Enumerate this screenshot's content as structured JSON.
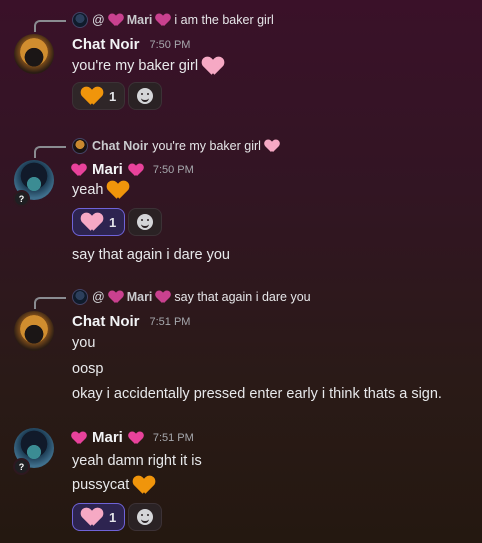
{
  "messages": [
    {
      "reply": {
        "prefix": "@",
        "name": "Mari",
        "text": "i am the baker girl"
      },
      "author": "Chat Noir",
      "time": "7:50 PM",
      "lines": [
        "you're my baker girl"
      ],
      "reaction_count": "1"
    },
    {
      "reply": {
        "name": "Chat Noir",
        "text": "you're my baker girl"
      },
      "author": "Mari",
      "time": "7:50 PM",
      "lines": [
        "yeah",
        "say that again i dare you"
      ],
      "reaction_count": "1",
      "avatar_badge": "?"
    },
    {
      "reply": {
        "prefix": "@",
        "name": "Mari",
        "text": "say that again i dare you"
      },
      "author": "Chat Noir",
      "time": "7:51 PM",
      "lines": [
        "you",
        "oosp",
        "okay i accidentally pressed enter early i think thats a sign."
      ]
    },
    {
      "author": "Mari",
      "time": "7:51 PM",
      "lines": [
        "yeah damn right it is",
        "pussycat"
      ],
      "reaction_count": "1",
      "avatar_badge": "?"
    }
  ],
  "colors": {
    "mention_heart": "#e8429b",
    "pink_heart": "#f6a9c4",
    "orange_heart": "#f0950b",
    "active_reaction_border": "#6f63d8"
  },
  "icons": [
    "heart-emoji",
    "orange-heart-emoji",
    "pink-heart-emoji",
    "add-reaction-smile-icon"
  ]
}
